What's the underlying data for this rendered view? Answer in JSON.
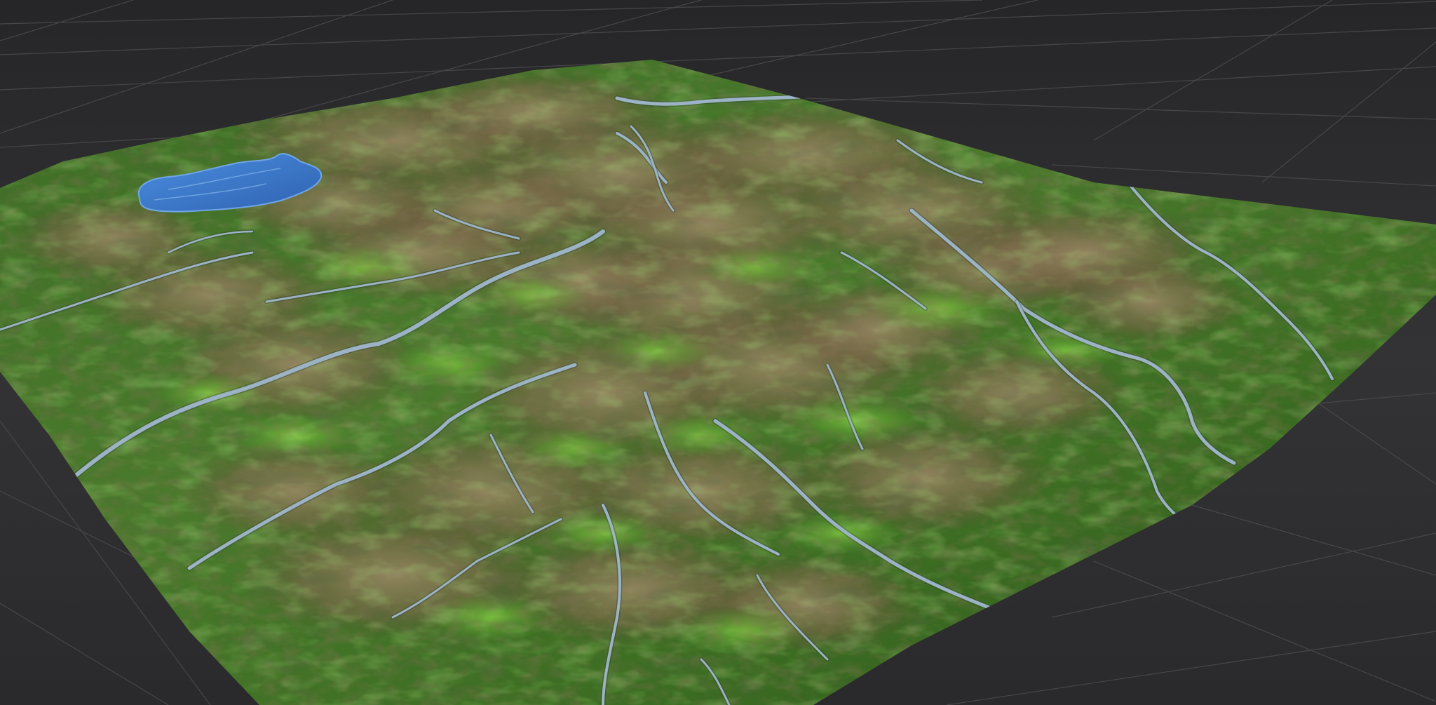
{
  "viewport": {
    "background_color": "#2c2c2e",
    "grid_line_color": "#4a4a4c"
  },
  "terrain": {
    "palette": {
      "forest_dark": "#2f5a1e",
      "forest_mid": "#3f7a25",
      "meadow_light": "#6fb83a",
      "rock_brown": "#7a6448",
      "rock_light": "#a48b6c",
      "river": "#9bb3c4",
      "lake": "#3a78c8"
    },
    "features": [
      "lake",
      "rivers",
      "mountain-ridges",
      "forest-valleys"
    ]
  }
}
